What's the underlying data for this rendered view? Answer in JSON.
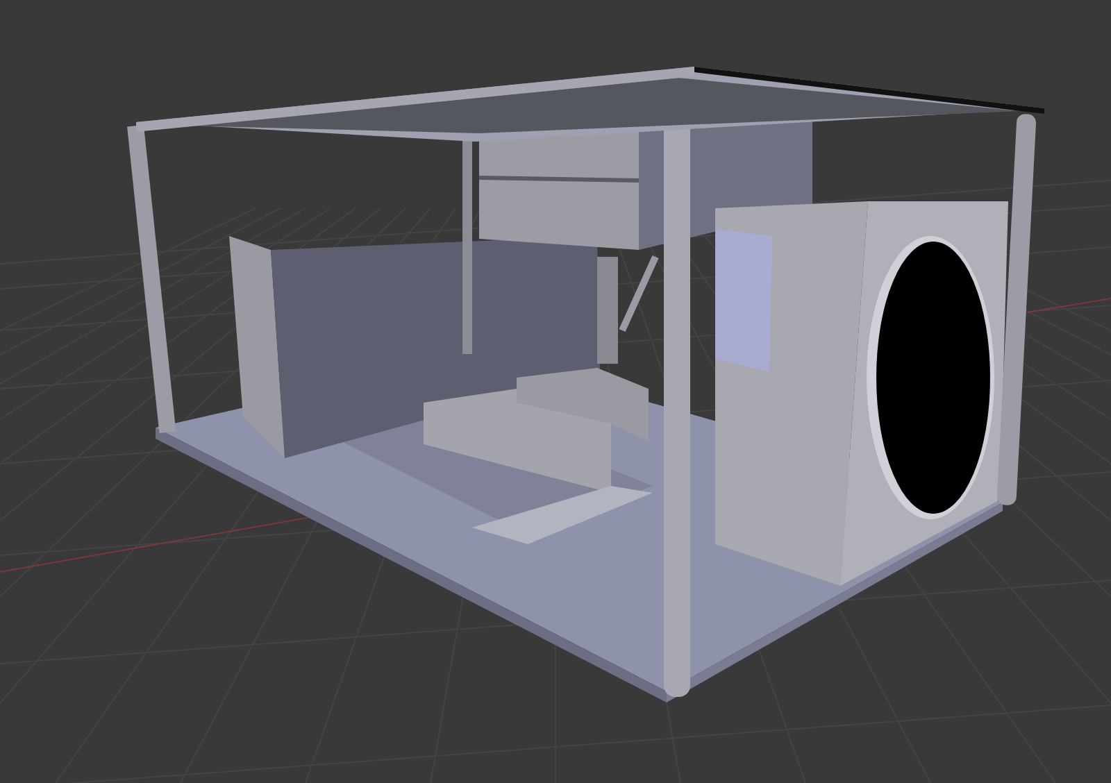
{
  "viewport": {
    "kind": "solid"
  }
}
